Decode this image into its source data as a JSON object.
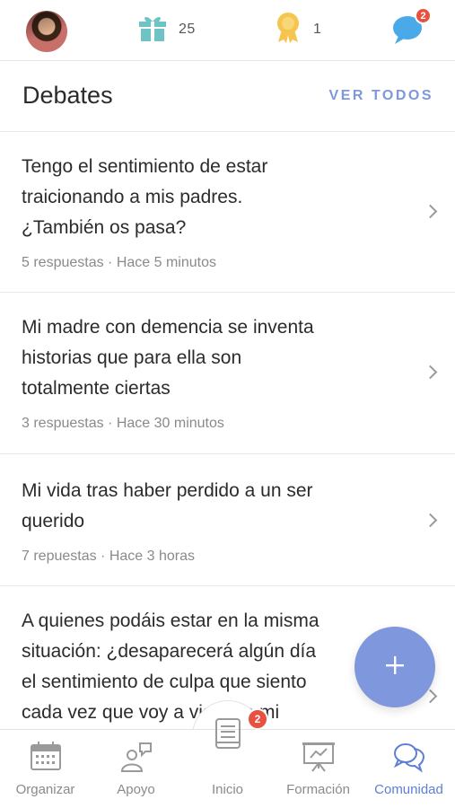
{
  "topbar": {
    "gift_count": "25",
    "medal_count": "1",
    "chat_badge": "2"
  },
  "section": {
    "title": "Debates",
    "action": "VER TODOS"
  },
  "debates": [
    {
      "title_lines": [
        "Tengo el sentimiento de estar",
        "traicionando a mis padres.",
        "¿También os pasa?"
      ],
      "meta": "5 respuestas · Hace 5 minutos"
    },
    {
      "title_lines": [
        "Mi madre con demencia se inventa",
        "historias que para ella son",
        "totalmente ciertas"
      ],
      "meta": "3 respuestas · Hace 30 minutos"
    },
    {
      "title_lines": [
        "Mi vida tras haber perdido a un ser",
        "querido"
      ],
      "meta": "7 repuestas · Hace 3 horas"
    },
    {
      "title_lines": [
        "A quienes podáis estar en la misma",
        "situación: ¿desaparecerá algún día",
        "el sentimiento de culpa que siento",
        "cada vez que voy a visitar a mi"
      ],
      "meta": ""
    }
  ],
  "fab": {
    "icon": "plus-icon"
  },
  "bottomnav": {
    "items": [
      {
        "label": "Organizar",
        "icon": "calendar-icon"
      },
      {
        "label": "Apoyo",
        "icon": "support-icon"
      },
      {
        "label": "Inicio",
        "icon": "home-document-icon",
        "badge": "2"
      },
      {
        "label": "Formación",
        "icon": "presentation-icon"
      },
      {
        "label": "Comunidad",
        "icon": "community-chat-icon"
      }
    ],
    "active_index": 4
  },
  "colors": {
    "accent": "#7e97dd",
    "active_nav": "#5d7fd4",
    "badge": "#e8503f",
    "gift": "#6ec3c4",
    "medal": "#f5c54e",
    "chat": "#4aa9e8"
  }
}
